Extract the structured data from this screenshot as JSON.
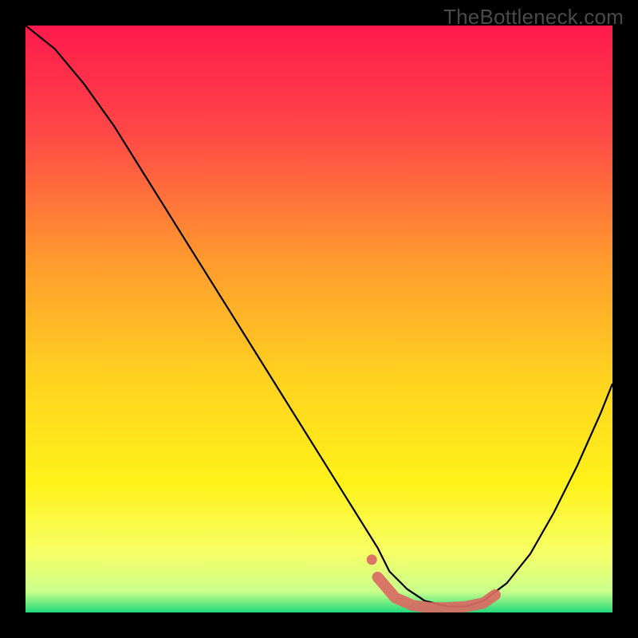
{
  "watermark": "TheBottleneck.com",
  "chart_data": {
    "type": "line",
    "title": "",
    "xlabel": "",
    "ylabel": "",
    "xlim": [
      0,
      100
    ],
    "ylim": [
      0,
      100
    ],
    "background_gradient": {
      "stops": [
        {
          "pos": 0.0,
          "color": "#ff1a4d"
        },
        {
          "pos": 0.18,
          "color": "#ff4747"
        },
        {
          "pos": 0.4,
          "color": "#ff9a2e"
        },
        {
          "pos": 0.6,
          "color": "#ffd21f"
        },
        {
          "pos": 0.78,
          "color": "#fff21a"
        },
        {
          "pos": 0.9,
          "color": "#f6ff66"
        },
        {
          "pos": 0.965,
          "color": "#c8ff8c"
        },
        {
          "pos": 1.0,
          "color": "#1fd97a"
        }
      ]
    },
    "series": [
      {
        "name": "bottleneck-curve",
        "color": "#000000",
        "x": [
          0,
          5,
          10,
          15,
          20,
          25,
          30,
          35,
          40,
          45,
          50,
          55,
          60,
          62,
          65,
          68,
          72,
          75,
          78,
          82,
          86,
          90,
          94,
          98,
          100
        ],
        "y": [
          100,
          96,
          90,
          83,
          75,
          67,
          59,
          51,
          43,
          35,
          27,
          19,
          11,
          7,
          4,
          2,
          1,
          1,
          2,
          5,
          10,
          17,
          25,
          34,
          39
        ]
      },
      {
        "name": "highlight-segment",
        "color": "#d96a63",
        "style": "thick-dotted",
        "x": [
          60,
          63,
          66,
          69,
          72,
          75,
          78,
          80
        ],
        "y": [
          6,
          2.5,
          1.2,
          0.8,
          0.8,
          1.0,
          1.6,
          3.0
        ]
      }
    ]
  }
}
